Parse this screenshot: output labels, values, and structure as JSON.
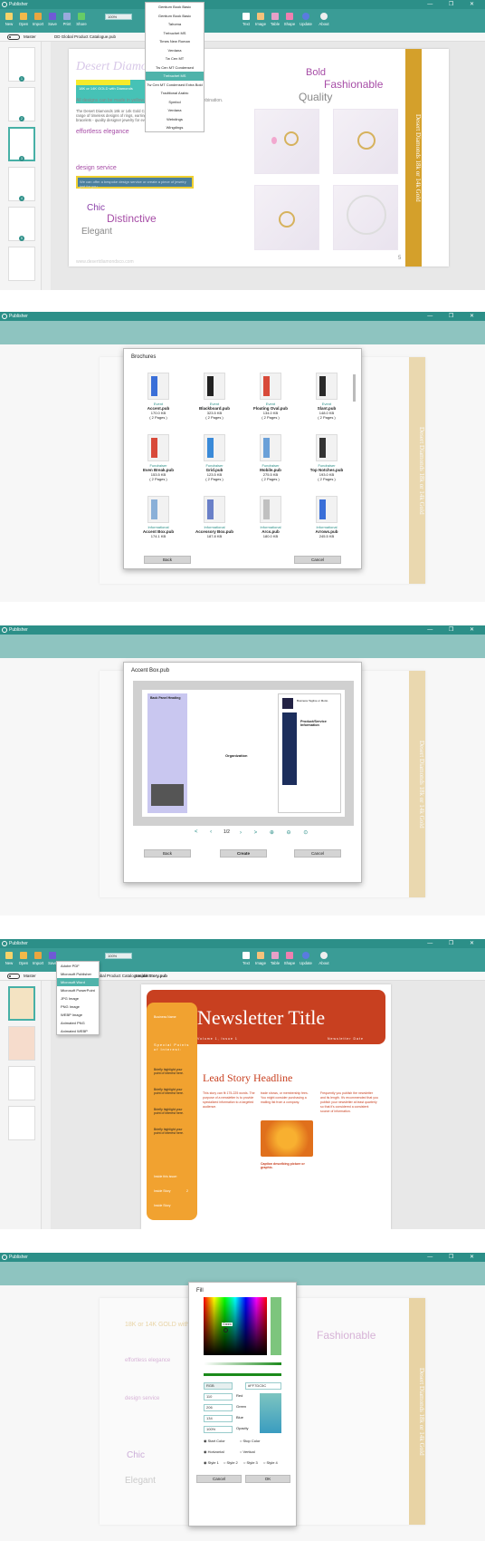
{
  "app": {
    "title": "Publisher",
    "window_controls": "— ❐ ✕"
  },
  "ribbon": {
    "buttons": [
      "New",
      "Open",
      "Import",
      "Save",
      "Print",
      "Share"
    ],
    "right_buttons": [
      "Text",
      "Image",
      "Table",
      "Shape",
      "Update",
      "About"
    ],
    "zoom_label": "Zoom",
    "zoom_value": "100%",
    "font_value": "Tahoma",
    "format_buttons": "B I U S"
  },
  "workspace": {
    "master_label": "Master",
    "tab_label": "DD Global Product Catalogue.pub",
    "tab_label_newsletter": "Inside Story.pub",
    "page_number": "5"
  },
  "catalogue": {
    "brand": "Desert Diamonds 18k",
    "bold": "Bold",
    "fashionable": "Fashionable",
    "quality": "Quality",
    "chic": "Chic",
    "distinctive": "Distinctive",
    "elegant": "Elegant",
    "highlight_text": "18K or 14K GOLD with Diamonds",
    "body1": "The Desert Diamonds 18k or 14k Gold Collection includes a vast range of timeless designs of rings, earrings, pendants, necklaces and bracelets - quality designer jewelry for every occasion.",
    "body_short": "All designs can be made in yellow, white or yellow gold, or a combination.",
    "heading_elegance": "effortless elegance",
    "heading_design": "design service",
    "design_box": "We can offer a bespoke design service or create a piece of jewelry just for you.",
    "website": "www.desertdiamondsco.com",
    "side_banner": "Desert Diamonds 18k or 14k Gold"
  },
  "font_menu": {
    "items": [
      "Gentium Book Basic",
      "Gentium Book Basic",
      "Tahoma",
      "Trebuchet MS",
      "Times New Roman",
      "Verdana",
      "Tw Cen MT",
      "Tw Cen MT Condensed",
      "Tw Cen MT Condensed Extra Bold",
      "Traditional Arabic",
      "Trebuchet MS",
      "Symbol",
      "Verdana",
      "Webdings",
      "Wingdings"
    ],
    "selected": "Trebuchet MS"
  },
  "brochure_dialog": {
    "title": "Brochures",
    "back": "Back",
    "cancel": "Cancel",
    "templates": [
      {
        "cat": "Event",
        "name": "Accent.pub",
        "size": "170.0 KB",
        "pages": "( 2 Pages )"
      },
      {
        "cat": "Event",
        "name": "Blackboard.pub",
        "size": "323.5 KB",
        "pages": "( 2 Pages )"
      },
      {
        "cat": "Event",
        "name": "Floating Oval.pub",
        "size": "134.0 KB",
        "pages": "( 2 Pages )"
      },
      {
        "cat": "Event",
        "name": "Slant.pub",
        "size": "148.0 KB",
        "pages": "( 2 Pages )"
      },
      {
        "cat": "Fundraiser",
        "name": "Even Break.pub",
        "size": "153.5 KB",
        "pages": "( 2 Pages )"
      },
      {
        "cat": "Fundraiser",
        "name": "Grid.pub",
        "size": "123.5 KB",
        "pages": "( 2 Pages )"
      },
      {
        "cat": "Fundraiser",
        "name": "Mobile.pub",
        "size": "275.5 KB",
        "pages": "( 2 Pages )"
      },
      {
        "cat": "Fundraiser",
        "name": "Top Notches.pub",
        "size": "193.0 KB",
        "pages": "( 2 Pages )"
      },
      {
        "cat": "Informational",
        "name": "Accent Box.pub",
        "size": "174.1 KB",
        "pages": ""
      },
      {
        "cat": "Informational",
        "name": "Accessory Box.pub",
        "size": "187.8 KB",
        "pages": ""
      },
      {
        "cat": "Informational",
        "name": "Arcs.pub",
        "size": "180.0 KB",
        "pages": ""
      },
      {
        "cat": "Informational",
        "name": "Arrows.pub",
        "size": "245.5 KB",
        "pages": ""
      }
    ]
  },
  "preview_dialog": {
    "title": "Accent Box.pub",
    "back": "Back",
    "create": "Create",
    "cancel": "Cancel",
    "page_indicator": "1/2",
    "left_panel_title": "Back Panel Heading",
    "org_name": "Organization",
    "product_title": "Product/Service Information",
    "business_tagline": "Business Tagline or Motto"
  },
  "export_menu": {
    "items": [
      "Adobe PDF",
      "Microsoft Publisher",
      "Microsoft Word",
      "Microsoft PowerPoint",
      "JPG Image",
      "PNG Image",
      "WEBP Image",
      "Animated PNG",
      "Animated WEBP"
    ],
    "selected": "Microsoft Word"
  },
  "newsletter": {
    "title": "Newsletter Title",
    "issue": "Volume 1, Issue 1",
    "date": "Newsletter Date",
    "business_name": "Business Name",
    "special_points": "Special Points of Interest:",
    "bullet": "Briefly highlight your point of interest here.",
    "inside": "Inside this issue:",
    "inside_item": "Inside Story",
    "inside_page": "2",
    "headline": "Lead Story Headline",
    "col1": "This story can fit 175-225 words. The purpose of a newsletter is to provide specialized information to a targeted audience.",
    "col2": "trade shows, or membership fees. You might consider purchasing a mailing list from a company.",
    "col3": "Frequently you publish the newsletter and its length. It's recommended that you publish your newsletter at least quarterly so that it's considered a consistent source of information.",
    "caption": "Caption describing picture or graphic."
  },
  "fill_dialog": {
    "title": "Fill",
    "preview_label": "Green",
    "mode": "RGB",
    "hex": "#FF7DC5C",
    "red_value": "110",
    "red_label": "Red",
    "green_value": "206",
    "green_label": "Green",
    "blue_value": "134",
    "blue_label": "Blue",
    "opacity_value": "100%",
    "opacity_label": "Opacity",
    "start_color": "Start Color",
    "stop_color": "Stop Color",
    "horizontal": "Horizontal",
    "vertical": "Vertical",
    "style1": "Style 1",
    "style2": "Style 2",
    "style3": "Style 3",
    "style4": "Style 4",
    "cancel": "Cancel",
    "ok": "OK"
  },
  "colors": {
    "teal": "#2c8f88",
    "gold": "#d4a02b",
    "purple": "#a64ca6",
    "green": "#7dc57d"
  }
}
